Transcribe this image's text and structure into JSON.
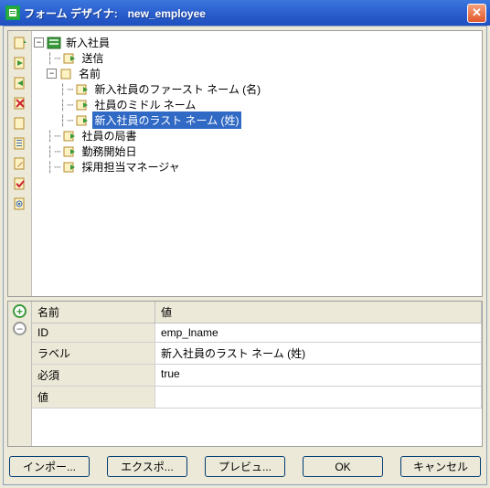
{
  "title_prefix": "フォーム デザイナ:",
  "title_name": "new_employee",
  "tree": {
    "root": "新入社員",
    "n_send": "送信",
    "n_name": "名前",
    "n_first": "新入社員のファースト ネーム (名)",
    "n_middle": "社員のミドル ネーム",
    "n_last": "新入社員のラスト ネーム (姓)",
    "n_dept": "社員の局書",
    "n_start": "勤務開始日",
    "n_mgr": "採用担当マネージャ"
  },
  "props": {
    "header_name": "名前",
    "header_value": "値",
    "rows": [
      {
        "k": "ID",
        "v": "emp_lname"
      },
      {
        "k": "ラベル",
        "v": "新入社員のラスト ネーム (姓)"
      },
      {
        "k": "必須",
        "v": "true"
      },
      {
        "k": "値",
        "v": ""
      }
    ]
  },
  "buttons": {
    "import": "インポー...",
    "export": "エクスポ...",
    "preview": "プレビュ...",
    "ok": "OK",
    "cancel": "キャンセル"
  }
}
